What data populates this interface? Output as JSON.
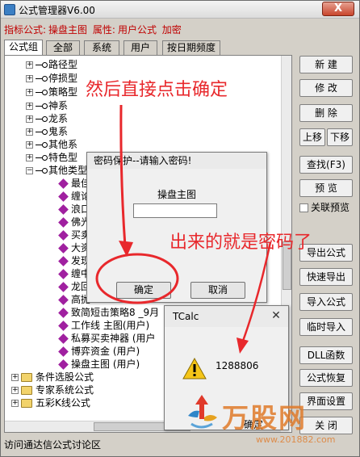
{
  "window": {
    "title": "公式管理器V6.00",
    "close_label": "X"
  },
  "infobar": {
    "formula_label": "指标公式:",
    "formula_name": "操盘主图",
    "attr_label": "属性:",
    "attr_value": "用户公式",
    "encrypted": "加密"
  },
  "tabs": [
    "公式组",
    "全部",
    "系统",
    "用户",
    "按日期频度"
  ],
  "tree": {
    "groups": [
      "路径型",
      "停损型",
      "策略型",
      "神系",
      "龙系",
      "鬼系",
      "其他系",
      "特色型",
      "其他类型"
    ],
    "formulas": [
      {
        "text": "最佳"
      },
      {
        "text": "缠论"
      },
      {
        "text": "浪口"
      },
      {
        "text": "佛光"
      },
      {
        "text": "买卖"
      },
      {
        "text": "大资"
      },
      {
        "text": "发现"
      },
      {
        "text": "缠中"
      },
      {
        "text": "龙回"
      },
      {
        "text": "高抛"
      },
      {
        "text": "致简短击策略8    _9月"
      },
      {
        "text": "工作线    主图(用户)"
      },
      {
        "text": "私募买卖神器    (用户"
      },
      {
        "text": "博弈资金    (用户)"
      },
      {
        "text": "操盘主图    (用户)"
      }
    ],
    "folders": [
      "条件选股公式",
      "专家系统公式",
      "五彩K线公式"
    ]
  },
  "side_buttons": {
    "new": "新 建",
    "modify": "修 改",
    "delete": "删 除",
    "up": "上移",
    "down": "下移",
    "find": "查找(F3)",
    "preview": "预 览",
    "related_preview": "关联预览",
    "export": "导出公式",
    "quick_export": "快速导出",
    "import": "导入公式",
    "temp_import": "临时导入",
    "dll": "DLL函数",
    "restore": "公式恢复",
    "ui_settings": "界面设置",
    "close": "关 闭"
  },
  "statusbar": {
    "text": "访问通达信公式讨论区"
  },
  "password_dialog": {
    "title": "密码保护--请输入密码!",
    "label": "操盘主图",
    "input_value": "",
    "ok": "确定",
    "cancel": "取消"
  },
  "tcalc": {
    "title": "TCalc",
    "value": "1288806",
    "ok": "确定"
  },
  "annotations": {
    "top": "然后直接点击确定",
    "middle": "出来的就是密码了"
  },
  "watermark": {
    "logo": "万股网",
    "url": "www.201882.com"
  },
  "colors": {
    "annotation": "#e8282c",
    "info_text": "#c00000",
    "formula_icon": "#a020a0",
    "watermark": "#e07b2a"
  }
}
